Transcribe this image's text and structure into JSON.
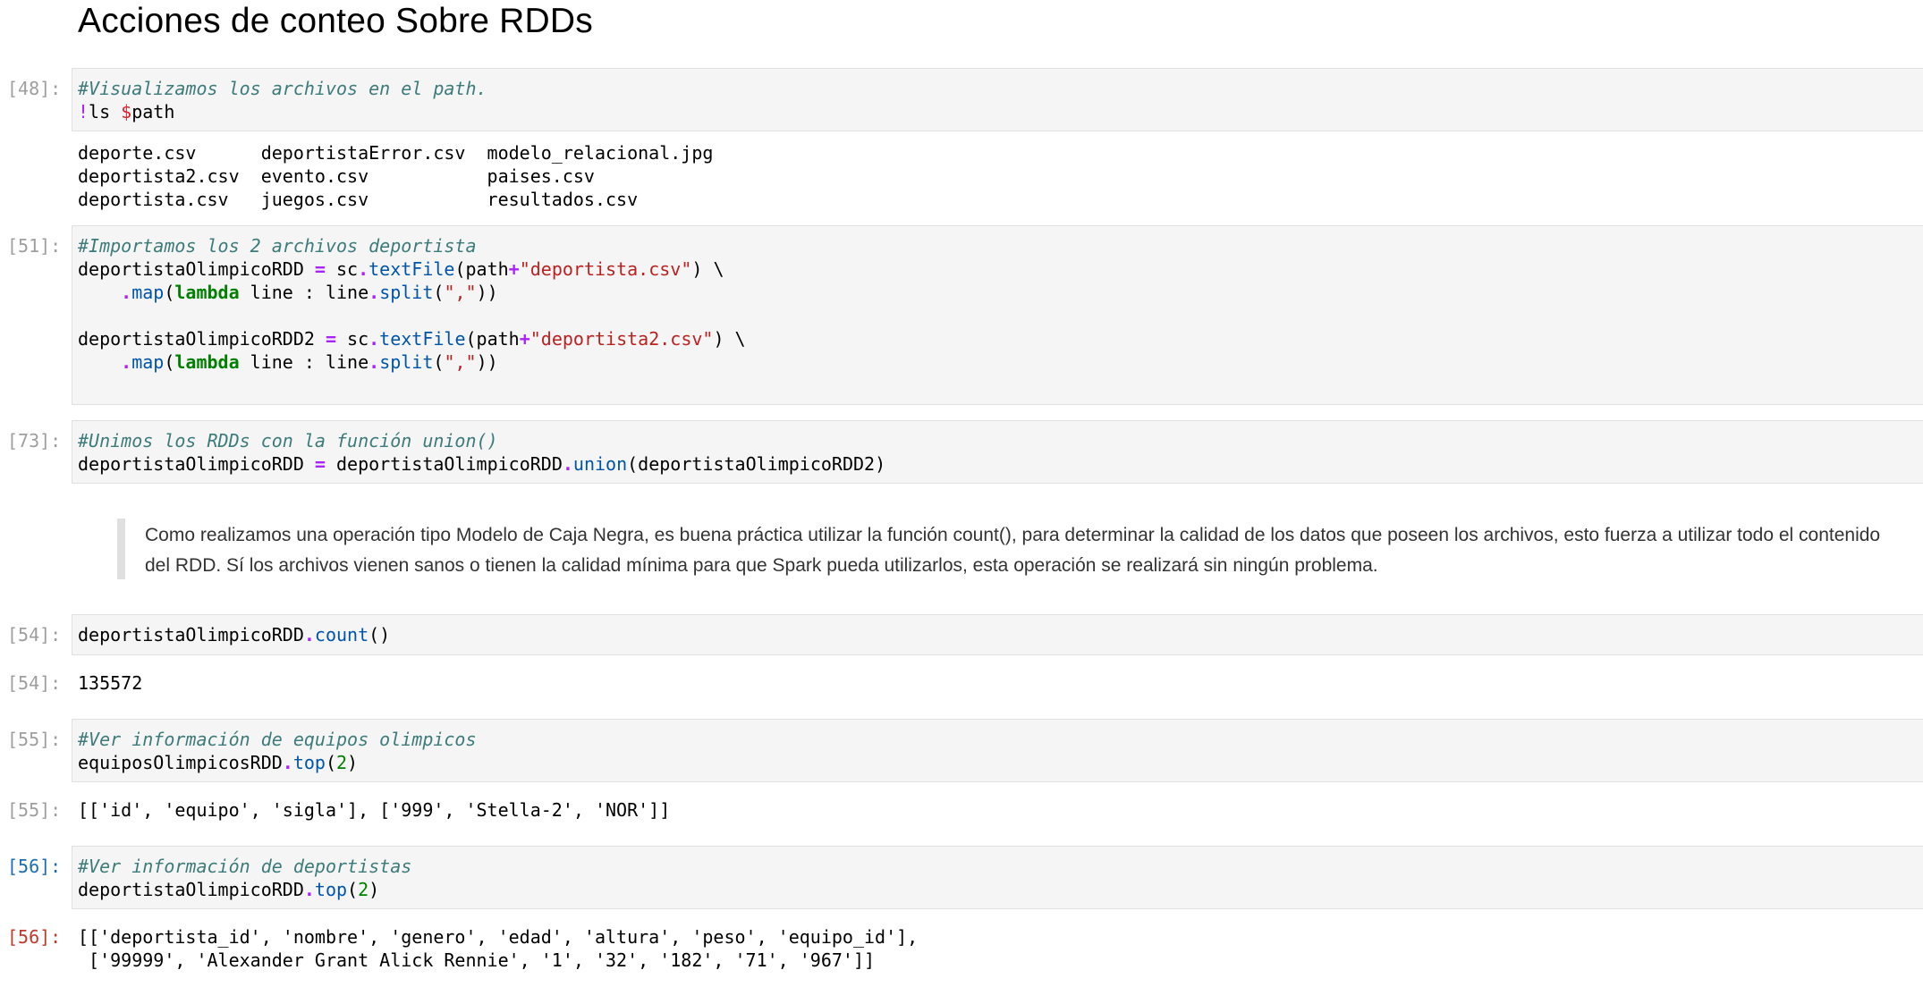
{
  "heading": "Acciones de conteo Sobre RDDs",
  "cells": {
    "c48_in_prompt": "[48]:",
    "c48_line1": "#Visualizamos los archivos en el path.",
    "c48_line2_bang": "!",
    "c48_line2_cmd": "ls ",
    "c48_line2_dollar": "$",
    "c48_line2_var": "path",
    "c48_output": "deporte.csv      deportistaError.csv  modelo_relacional.jpg\ndeportista2.csv  evento.csv           paises.csv\ndeportista.csv   juegos.csv           resultados.csv",
    "c51_in_prompt": "[51]:",
    "c51_comment": "#Importamos los 2 archivos deportista",
    "c73_in_prompt": "[73]:",
    "c73_comment": "#Unimos los RDDs con la función union()",
    "markdown_text": "Como realizamos una operación tipo Modelo de Caja Negra, es buena práctica utilizar la función count(), para determinar la calidad de los datos que poseen los archivos, esto fuerza a utilizar todo el contenido del RDD. Sí los archivos vienen sanos o tienen la calidad mínima para que Spark pueda utilizarlos, esta operación se realizará sin ningún problema.",
    "c54_in_prompt": "[54]:",
    "c54_out_prompt": "[54]:",
    "c54_output": "135572",
    "c55_in_prompt": "[55]:",
    "c55_comment": "#Ver información de equipos olimpicos",
    "c55_out_prompt": "[55]:",
    "c55_output": "[['id', 'equipo', 'sigla'], ['999', 'Stella-2', 'NOR']]",
    "c56_in_prompt": "[56]:",
    "c56_comment": "#Ver información de deportistas",
    "c56_out_prompt": "[56]:",
    "c56_output": "[['deportista_id', 'nombre', 'genero', 'edad', 'altura', 'peso', 'equipo_id'],\n ['99999', 'Alexander Grant Alick Rennie', '1', '32', '182', '71', '967']]"
  },
  "colors": {
    "prompt_inactive": "#9e9e9e",
    "prompt_in_active": "#1a6db3",
    "prompt_out_active": "#c0392b",
    "cell_background": "#f5f5f5"
  }
}
